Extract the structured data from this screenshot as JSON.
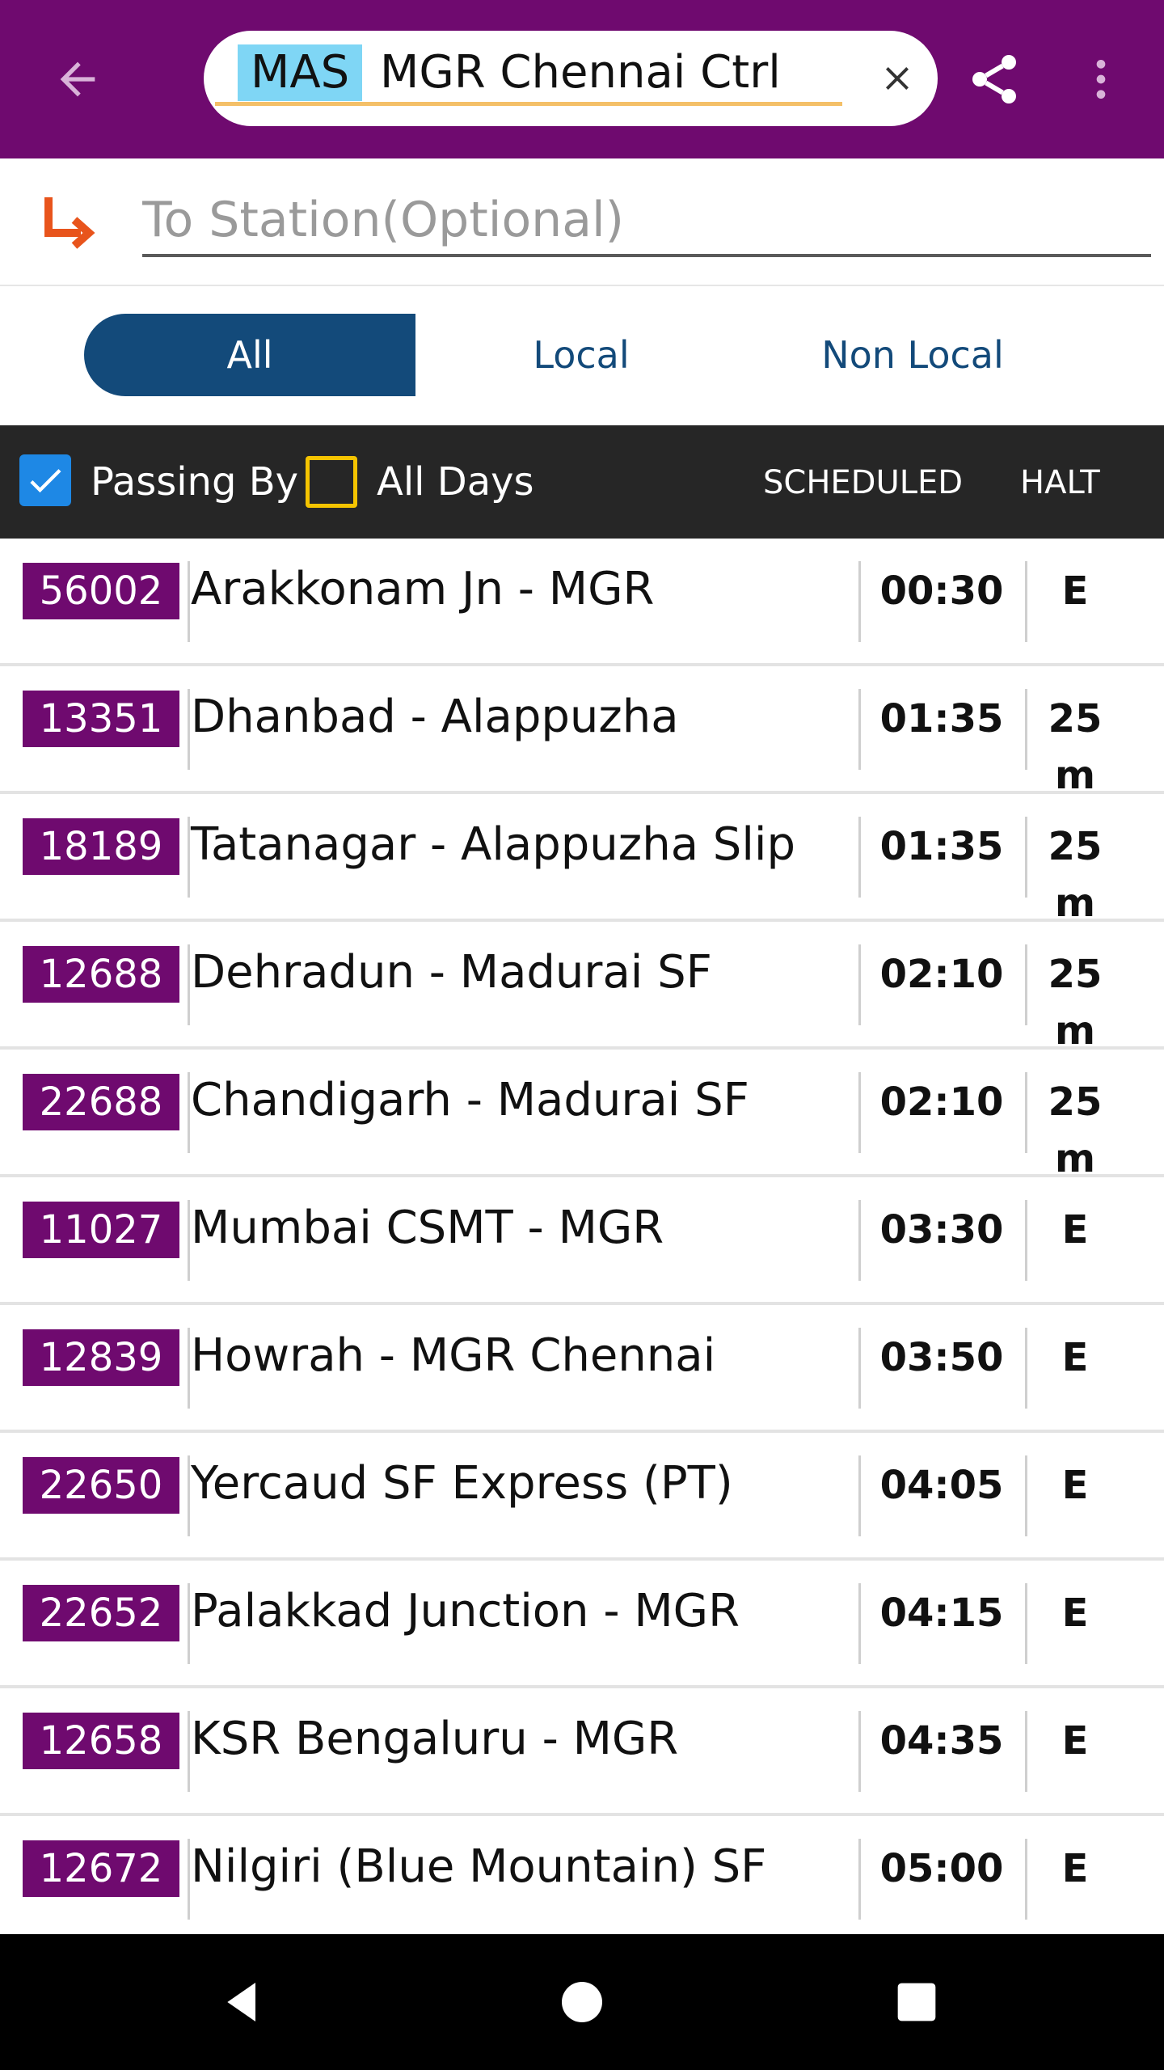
{
  "search": {
    "station_code": "MAS",
    "station_name": "MGR Chennai Ctrl"
  },
  "to_station": {
    "placeholder": "To Station(Optional)"
  },
  "filters": {
    "all": "All",
    "local": "Local",
    "non_local": "Non Local",
    "selected": "All"
  },
  "list_header": {
    "passing_by": "Passing By",
    "passing_by_checked": true,
    "all_days": "All Days",
    "all_days_checked": false,
    "scheduled": "SCHEDULED",
    "halt": "HALT"
  },
  "trains": [
    {
      "number": "56002",
      "name": "Arakkonam Jn - MGR",
      "time": "00:30",
      "halt": "E"
    },
    {
      "number": "13351",
      "name": "Dhanbad - Alappuzha",
      "time": "01:35",
      "halt": "25 m"
    },
    {
      "number": "18189",
      "name": "Tatanagar - Alappuzha Slip",
      "time": "01:35",
      "halt": "25 m"
    },
    {
      "number": "12688",
      "name": "Dehradun - Madurai SF",
      "time": "02:10",
      "halt": "25 m"
    },
    {
      "number": "22688",
      "name": "Chandigarh - Madurai SF",
      "time": "02:10",
      "halt": "25 m"
    },
    {
      "number": "11027",
      "name": "Mumbai CSMT - MGR",
      "time": "03:30",
      "halt": "E"
    },
    {
      "number": "12839",
      "name": "Howrah - MGR Chennai",
      "time": "03:50",
      "halt": "E"
    },
    {
      "number": "22650",
      "name": "Yercaud SF Express (PT)",
      "time": "04:05",
      "halt": "E"
    },
    {
      "number": "22652",
      "name": "Palakkad Junction - MGR",
      "time": "04:15",
      "halt": "E"
    },
    {
      "number": "12658",
      "name": "KSR Bengaluru - MGR",
      "time": "04:35",
      "halt": "E"
    },
    {
      "number": "12672",
      "name": "Nilgiri (Blue Mountain) SF",
      "time": "05:00",
      "halt": "E"
    }
  ],
  "colors": {
    "app_bar": "#6f0a6f",
    "code_highlight": "#7fd6f5",
    "segment_active": "#134a7a",
    "train_badge": "#6f0a6f",
    "route_icon": "#e8541c",
    "checkbox_checked": "#1e88e5",
    "checkbox_unchecked_border": "#f5c400"
  },
  "icons": {
    "back": "arrow-left-icon",
    "clear": "close-icon",
    "share": "share-icon",
    "more": "more-vertical-icon",
    "route": "route-turn-icon",
    "nav_back": "triangle-back-icon",
    "nav_home": "circle-home-icon",
    "nav_recents": "square-recents-icon"
  }
}
